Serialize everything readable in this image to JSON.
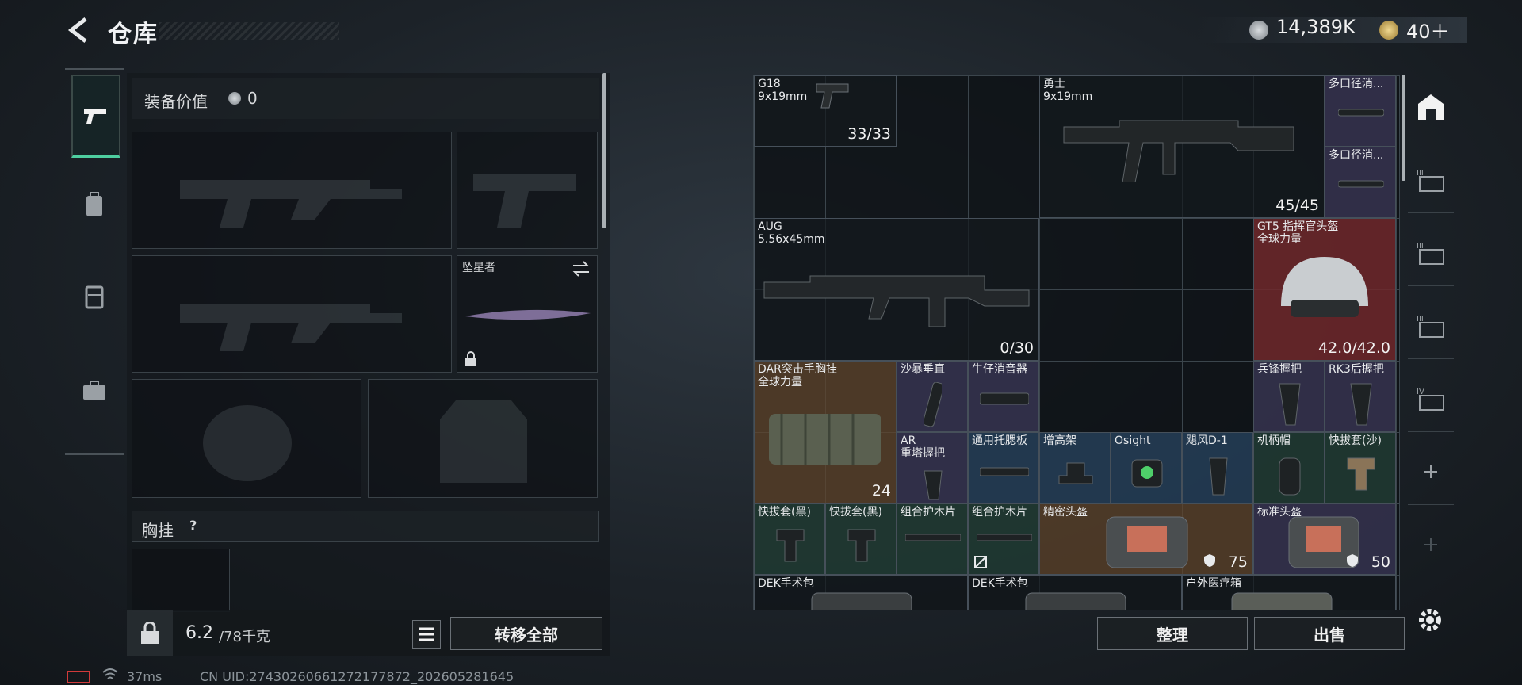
{
  "header": {
    "title": "仓库",
    "currency1": "14,389K",
    "currency2": "40＋"
  },
  "nav": {
    "items": [
      "weapon-icon",
      "backpack-icon",
      "vest-icon",
      "toolbox-icon"
    ]
  },
  "loadout": {
    "equip_value_label": "装备价值",
    "equip_value": "0",
    "melee_name": "坠星者",
    "chest_rig_label": "胸挂",
    "chest_rig_help": "?"
  },
  "footer_left": {
    "weight_current": "6.2",
    "weight_max": "/78千克",
    "transfer_all": "转移全部"
  },
  "footer_right": {
    "organize": "整理",
    "sell": "出售"
  },
  "stash_items": [
    {
      "name": "G18",
      "sub": "9x19mm",
      "count": "33/33"
    },
    {
      "name": "勇士",
      "sub": "9x19mm",
      "count": "45/45"
    },
    {
      "name": "多口径消..."
    },
    {
      "name": "多口径消..."
    },
    {
      "name": "AUG",
      "sub": "5.56x45mm",
      "count": "0/30"
    },
    {
      "name": "GT5 指挥官头盔",
      "sub": "全球力量",
      "count": "42.0/42.0"
    },
    {
      "name": "DAR突击手胸挂",
      "sub": "全球力量",
      "count": "24"
    },
    {
      "name": "沙暴垂直"
    },
    {
      "name": "牛仔消音器"
    },
    {
      "name": "兵锋握把"
    },
    {
      "name": "RK3后握把"
    },
    {
      "name": "AR",
      "sub": "重塔握把"
    },
    {
      "name": "通用托腮板"
    },
    {
      "name": "增高架"
    },
    {
      "name": "Osight"
    },
    {
      "name": "飓风D-1"
    },
    {
      "name": "机柄帽"
    },
    {
      "name": "快拔套(沙)"
    },
    {
      "name": "快拔套(黑)"
    },
    {
      "name": "快拔套(黑)"
    },
    {
      "name": "组合护木片"
    },
    {
      "name": "组合护木片"
    },
    {
      "name": "精密头盔",
      "count": "75"
    },
    {
      "name": "标准头盔",
      "count": "50"
    },
    {
      "name": "DEK手术包"
    },
    {
      "name": "DEK手术包"
    },
    {
      "name": "户外医疗箱"
    }
  ],
  "status": {
    "ping": "37ms",
    "uid": "CN UID:27430260661272177872_202605281645"
  },
  "colors": {
    "accent": "#4ecfa0",
    "rare_red": "#70282c",
    "gold": "#60462c"
  }
}
